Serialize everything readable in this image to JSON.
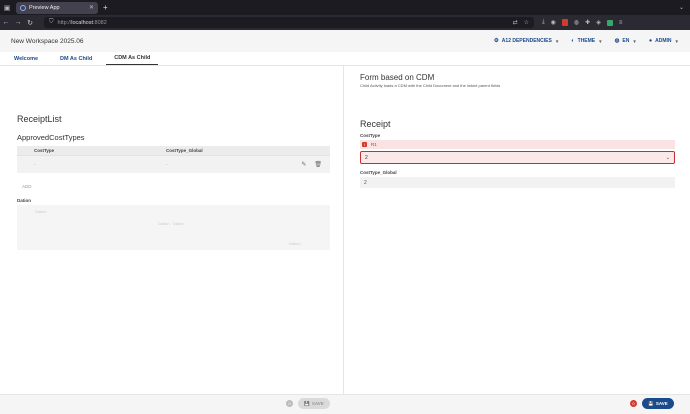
{
  "browser": {
    "tab_title": "Preview App",
    "url_scheme": "http://",
    "url_host": "localhost",
    "url_port": ":8082"
  },
  "header": {
    "workspace_title": "New Workspace 2025.06",
    "dependencies": "A12 DEPENDENCIES",
    "theme": "THEME",
    "language": "EN",
    "user": "ADMIN"
  },
  "tabs": [
    {
      "label": "Welcome"
    },
    {
      "label": "DM As Child"
    },
    {
      "label": "CDM As Child"
    }
  ],
  "left": {
    "receipt_list_title": "ReceiptList",
    "approved_title": "ApprovedCostTypes",
    "table": {
      "columns": [
        "CostType",
        "CostType_Global"
      ],
      "rows": [
        [
          "-",
          "-"
        ]
      ]
    },
    "add_label": "ADD",
    "dation_label": "Dation",
    "dation_placeholders": [
      "Dation",
      "Dation",
      "Dation",
      "Dation"
    ]
  },
  "right": {
    "form_title": "Form based on CDM",
    "form_subtitle": "Child Activity loads a CDM with the Child Document and the linked parent fields",
    "receipt_title": "Receipt",
    "costtype_label": "CostType",
    "error_text": "R1",
    "costtype_value": "2",
    "costtype_global_label": "CostType_Global",
    "costtype_global_value": "2"
  },
  "footer": {
    "left_save": "SAVE",
    "right_save": "SAVE",
    "left_status": "0",
    "right_status": "0"
  },
  "colors": {
    "accent": "#1a4b8c",
    "error": "#c53030",
    "error_bg": "#fbe3e3"
  }
}
